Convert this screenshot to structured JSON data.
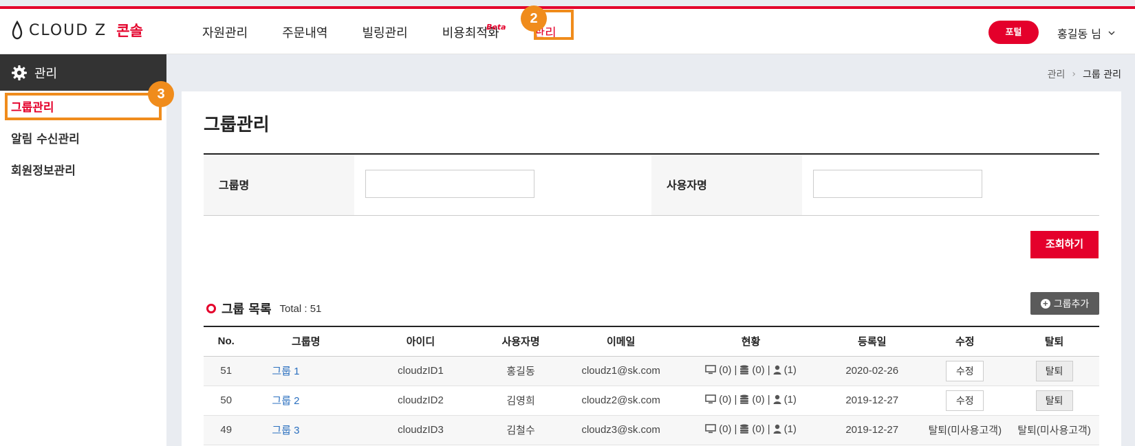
{
  "header": {
    "logo_text": "CLOUD Z",
    "logo_sub": "콘솔",
    "nav": [
      {
        "label": "자원관리"
      },
      {
        "label": "주문내역"
      },
      {
        "label": "빌링관리"
      },
      {
        "label": "비용최적화",
        "tag": "Beta"
      },
      {
        "label": "관리"
      }
    ],
    "portal_label": "포털",
    "user_label": "홍길동 님"
  },
  "annotations": {
    "nav_badge": "2",
    "sidebar_badge": "3"
  },
  "sidebar": {
    "title": "관리",
    "items": [
      {
        "label": "그룹관리"
      },
      {
        "label": "알림 수신관리"
      },
      {
        "label": "회원정보관리"
      }
    ]
  },
  "breadcrumb": {
    "parent": "관리",
    "current": "그룹 관리"
  },
  "page": {
    "title": "그룹관리"
  },
  "search": {
    "group_label": "그룹명",
    "group_value": "",
    "user_label": "사용자명",
    "user_value": "",
    "submit_label": "조회하기"
  },
  "list": {
    "title": "그룹 목록",
    "total": "Total : 51",
    "add_label": "그룹추가",
    "columns": [
      "No.",
      "그룹명",
      "아이디",
      "사용자명",
      "이메일",
      "현황",
      "등록일",
      "수정",
      "탈퇴"
    ],
    "rows": [
      {
        "no": "51",
        "group": "그룹 1",
        "id": "cloudzID1",
        "user": "홍길동",
        "email": "cloudz1@sk.com",
        "s1": "(0)",
        "s2": "(0)",
        "s3": "(1)",
        "date": "2020-02-26",
        "edit": "수정",
        "quit": "탈퇴"
      },
      {
        "no": "50",
        "group": "그룹 2",
        "id": "cloudzID2",
        "user": "김영희",
        "email": "cloudz2@sk.com",
        "s1": "(0)",
        "s2": "(0)",
        "s3": "(1)",
        "date": "2019-12-27",
        "edit": "수정",
        "quit": "탈퇴"
      },
      {
        "no": "49",
        "group": "그룹 3",
        "id": "cloudzID3",
        "user": "김철수",
        "email": "cloudz3@sk.com",
        "s1": "(0)",
        "s2": "(0)",
        "s3": "(1)",
        "date": "2019-12-27",
        "edit": "탈퇴(미사용고객)",
        "quit": "탈퇴(미사용고객)"
      }
    ]
  },
  "colors": {
    "accent": "#e4002b",
    "highlight": "#f08c1c",
    "link": "#2a6fbf"
  }
}
